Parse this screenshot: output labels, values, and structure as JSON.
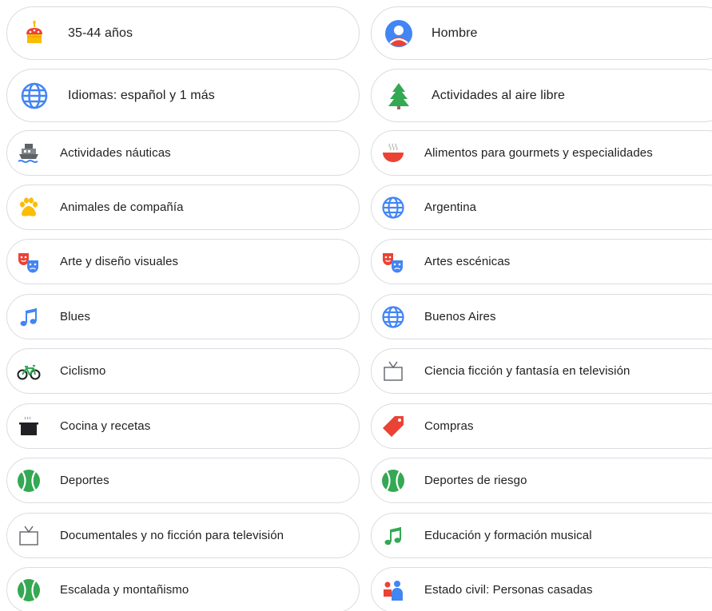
{
  "chips": {
    "age": {
      "label": "35-44 años",
      "icon": "birthday-cake-icon"
    },
    "gender": {
      "label": "Hombre",
      "icon": "person-icon"
    },
    "languages": {
      "label": "Idiomas: español y 1 más",
      "icon": "globe-icon"
    },
    "outdoor": {
      "label": "Actividades al aire libre",
      "icon": "pine-tree-icon"
    },
    "nautical": {
      "label": "Actividades náuticas",
      "icon": "ship-icon"
    },
    "gourmet": {
      "label": "Alimentos para gourmets y especialidades",
      "icon": "soup-bowl-icon"
    },
    "pets": {
      "label": "Animales de compañía",
      "icon": "paw-icon"
    },
    "argentina": {
      "label": "Argentina",
      "icon": "globe-icon"
    },
    "visual_art": {
      "label": "Arte y diseño visuales",
      "icon": "theater-masks-icon"
    },
    "performing_arts": {
      "label": "Artes escénicas",
      "icon": "theater-masks-icon"
    },
    "blues": {
      "label": "Blues",
      "icon": "music-note-icon"
    },
    "buenos_aires": {
      "label": "Buenos Aires",
      "icon": "globe-icon"
    },
    "cycling": {
      "label": "Ciclismo",
      "icon": "bicycle-icon"
    },
    "scifi_tv": {
      "label": "Ciencia ficción y fantasía en televisión",
      "icon": "tv-icon"
    },
    "cooking": {
      "label": "Cocina y recetas",
      "icon": "cooking-pot-icon"
    },
    "shopping": {
      "label": "Compras",
      "icon": "price-tag-icon"
    },
    "sports": {
      "label": "Deportes",
      "icon": "tennis-ball-icon"
    },
    "extreme_sports": {
      "label": "Deportes de riesgo",
      "icon": "tennis-ball-icon"
    },
    "documentaries": {
      "label": "Documentales y no ficción para televisión",
      "icon": "tv-icon"
    },
    "music_education": {
      "label": "Educación y formación musical",
      "icon": "music-note-icon"
    },
    "climbing": {
      "label": "Escalada y montañismo",
      "icon": "tennis-ball-icon"
    },
    "marital_status": {
      "label": "Estado civil: Personas casadas",
      "icon": "couple-icon"
    }
  },
  "colors": {
    "border": "#dadce0",
    "text": "#202124",
    "blue": "#4285f4",
    "red": "#ea4335",
    "green": "#34a853",
    "yellow": "#fbbc04"
  }
}
